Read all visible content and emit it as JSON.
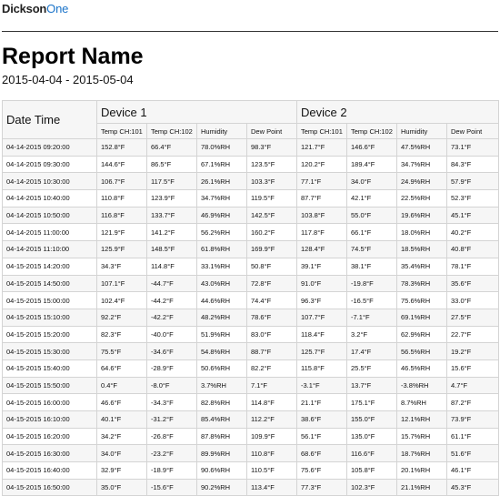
{
  "brand": {
    "part1": "Dickson",
    "part2": "One"
  },
  "report": {
    "title": "Report Name",
    "date_range": "2015-04-04 - 2015-05-04"
  },
  "table": {
    "datetime_header": "Date Time",
    "devices": [
      "Device 1",
      "Device 2"
    ],
    "columns": [
      "Temp CH:101",
      "Temp CH:102",
      "Humidity",
      "Dew Point",
      "Temp CH:101",
      "Temp CH:102",
      "Humidity",
      "Dew Point"
    ],
    "rows": [
      [
        "04-14-2015 09:20:00",
        "152.8°F",
        "66.4°F",
        "78.0%RH",
        "98.3°F",
        "121.7°F",
        "146.6°F",
        "47.5%RH",
        "73.1°F"
      ],
      [
        "04-14-2015 09:30:00",
        "144.6°F",
        "86.5°F",
        "67.1%RH",
        "123.5°F",
        "120.2°F",
        "189.4°F",
        "34.7%RH",
        "84.3°F"
      ],
      [
        "04-14-2015 10:30:00",
        "106.7°F",
        "117.5°F",
        "26.1%RH",
        "103.3°F",
        "77.1°F",
        "34.0°F",
        "24.9%RH",
        "57.9°F"
      ],
      [
        "04-14-2015 10:40:00",
        "110.8°F",
        "123.9°F",
        "34.7%RH",
        "119.5°F",
        "87.7°F",
        "42.1°F",
        "22.5%RH",
        "52.3°F"
      ],
      [
        "04-14-2015 10:50:00",
        "116.8°F",
        "133.7°F",
        "46.9%RH",
        "142.5°F",
        "103.8°F",
        "55.0°F",
        "19.6%RH",
        "45.1°F"
      ],
      [
        "04-14-2015 11:00:00",
        "121.9°F",
        "141.2°F",
        "56.2%RH",
        "160.2°F",
        "117.8°F",
        "66.1°F",
        "18.0%RH",
        "40.2°F"
      ],
      [
        "04-14-2015 11:10:00",
        "125.9°F",
        "148.5°F",
        "61.8%RH",
        "169.9°F",
        "128.4°F",
        "74.5°F",
        "18.5%RH",
        "40.8°F"
      ],
      [
        "04-15-2015 14:20:00",
        "34.3°F",
        "114.8°F",
        "33.1%RH",
        "50.8°F",
        "39.1°F",
        "38.1°F",
        "35.4%RH",
        "78.1°F"
      ],
      [
        "04-15-2015 14:50:00",
        "107.1°F",
        "-44.7°F",
        "43.0%RH",
        "72.8°F",
        "91.0°F",
        "-19.8°F",
        "78.3%RH",
        "35.6°F"
      ],
      [
        "04-15-2015 15:00:00",
        "102.4°F",
        "-44.2°F",
        "44.6%RH",
        "74.4°F",
        "96.3°F",
        "-16.5°F",
        "75.6%RH",
        "33.0°F"
      ],
      [
        "04-15-2015 15:10:00",
        "92.2°F",
        "-42.2°F",
        "48.2%RH",
        "78.6°F",
        "107.7°F",
        "-7.1°F",
        "69.1%RH",
        "27.5°F"
      ],
      [
        "04-15-2015 15:20:00",
        "82.3°F",
        "-40.0°F",
        "51.9%RH",
        "83.0°F",
        "118.4°F",
        "3.2°F",
        "62.9%RH",
        "22.7°F"
      ],
      [
        "04-15-2015 15:30:00",
        "75.5°F",
        "-34.6°F",
        "54.8%RH",
        "88.7°F",
        "125.7°F",
        "17.4°F",
        "56.5%RH",
        "19.2°F"
      ],
      [
        "04-15-2015 15:40:00",
        "64.6°F",
        "-28.9°F",
        "50.6%RH",
        "82.2°F",
        "115.8°F",
        "25.5°F",
        "46.5%RH",
        "15.6°F"
      ],
      [
        "04-15-2015 15:50:00",
        "0.4°F",
        "-8.0°F",
        "3.7%RH",
        "7.1°F",
        "-3.1°F",
        "13.7°F",
        "-3.8%RH",
        "4.7°F"
      ],
      [
        "04-15-2015 16:00:00",
        "46.6°F",
        "-34.3°F",
        "82.8%RH",
        "114.8°F",
        "21.1°F",
        "175.1°F",
        "8.7%RH",
        "87.2°F"
      ],
      [
        "04-15-2015 16:10:00",
        "40.1°F",
        "-31.2°F",
        "85.4%RH",
        "112.2°F",
        "38.6°F",
        "155.0°F",
        "12.1%RH",
        "73.9°F"
      ],
      [
        "04-15-2015 16:20:00",
        "34.2°F",
        "-26.8°F",
        "87.8%RH",
        "109.9°F",
        "56.1°F",
        "135.0°F",
        "15.7%RH",
        "61.1°F"
      ],
      [
        "04-15-2015 16:30:00",
        "34.0°F",
        "-23.2°F",
        "89.9%RH",
        "110.8°F",
        "68.6°F",
        "116.6°F",
        "18.7%RH",
        "51.6°F"
      ],
      [
        "04-15-2015 16:40:00",
        "32.9°F",
        "-18.9°F",
        "90.6%RH",
        "110.5°F",
        "75.6°F",
        "105.8°F",
        "20.1%RH",
        "46.1°F"
      ],
      [
        "04-15-2015 16:50:00",
        "35.0°F",
        "-15.6°F",
        "90.2%RH",
        "113.4°F",
        "77.3°F",
        "102.3°F",
        "21.1%RH",
        "45.3°F"
      ]
    ]
  }
}
